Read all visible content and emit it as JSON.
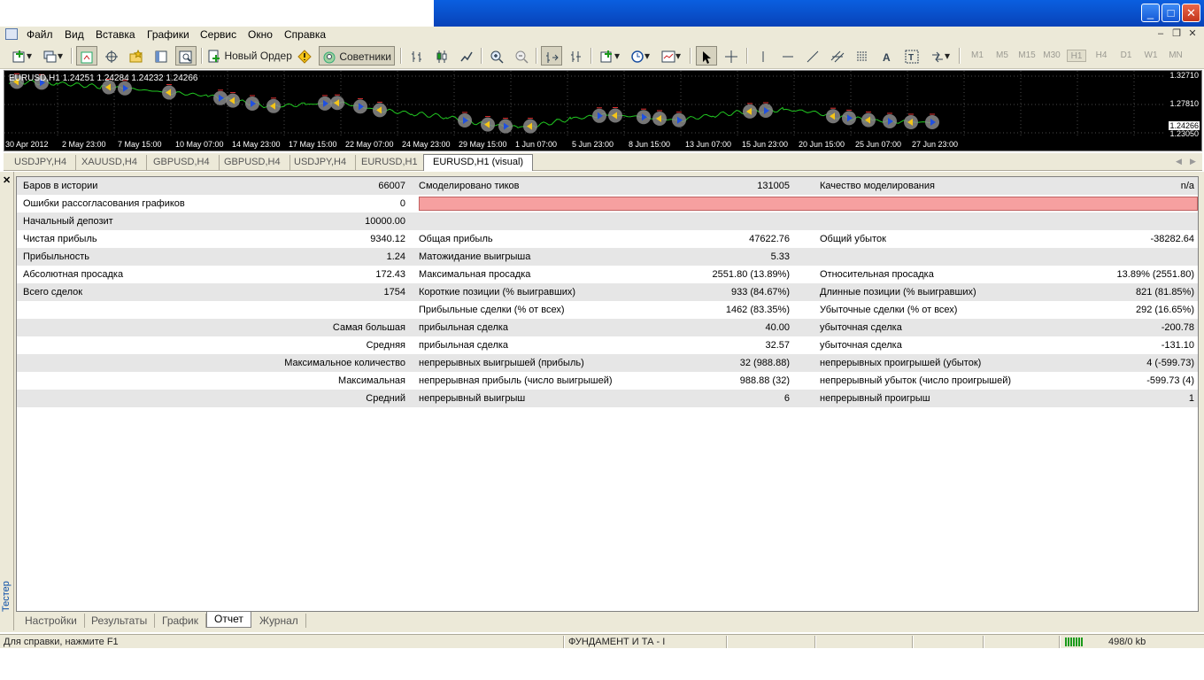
{
  "menu": [
    "Файл",
    "Вид",
    "Вставка",
    "Графики",
    "Сервис",
    "Окно",
    "Справка"
  ],
  "toolbar": {
    "new_order": "Новый Ордер",
    "advisors": "Советники",
    "timeframes": [
      "M1",
      "M5",
      "M15",
      "M30",
      "H1",
      "H4",
      "D1",
      "W1",
      "MN"
    ],
    "active_timeframe": "H1"
  },
  "chart": {
    "symbol_line": "EURUSD,H1  1.24251 1.24284 1.24232 1.24266",
    "prices": [
      "1.32710",
      "1.27810",
      "1.23050"
    ],
    "current_price": "1.24266",
    "times": [
      "30 Apr 2012",
      "2 May 23:00",
      "7 May 15:00",
      "10 May 07:00",
      "14 May 23:00",
      "17 May 15:00",
      "22 May 07:00",
      "24 May 23:00",
      "29 May 15:00",
      "1 Jun 07:00",
      "5 Jun 23:00",
      "8 Jun 15:00",
      "13 Jun 07:00",
      "15 Jun 23:00",
      "20 Jun 15:00",
      "25 Jun 07:00",
      "27 Jun 23:00"
    ],
    "line_color": "#21c721"
  },
  "chart_tabs": [
    "USDJPY,H4",
    "XAUUSD,H4",
    "GBPUSD,H4",
    "GBPUSD,H4",
    "USDJPY,H4",
    "EURUSD,H1",
    "EURUSD,H1 (visual)"
  ],
  "report": {
    "r1": {
      "l1": "Баров в истории",
      "v1": "66007",
      "l2": "Смоделировано тиков",
      "v2": "131005",
      "l3": "Качество моделирования",
      "v3": "n/a"
    },
    "r2": {
      "l1": "Ошибки рассогласования графиков",
      "v1": "0"
    },
    "r3": {
      "l1": "Начальный депозит",
      "v1": "10000.00"
    },
    "r4": {
      "l1": "Чистая прибыль",
      "v1": "9340.12",
      "l2": "Общая прибыль",
      "v2": "47622.76",
      "l3": "Общий убыток",
      "v3": "-38282.64"
    },
    "r5": {
      "l1": "Прибыльность",
      "v1": "1.24",
      "l2": "Матожидание выигрыша",
      "v2": "5.33"
    },
    "r6": {
      "l1": "Абсолютная просадка",
      "v1": "172.43",
      "l2": "Максимальная просадка",
      "v2": "2551.80 (13.89%)",
      "l3": "Относительная просадка",
      "v3": "13.89% (2551.80)"
    },
    "r7": {
      "l1": "Всего сделок",
      "v1": "1754",
      "l2": "Короткие позиции (% выигравших)",
      "v2": "933 (84.67%)",
      "l3": "Длинные позиции (% выигравших)",
      "v3": "821 (81.85%)"
    },
    "r8": {
      "l2": "Прибыльные сделки (% от всех)",
      "v2": "1462 (83.35%)",
      "l3": "Убыточные сделки (% от всех)",
      "v3": "292 (16.65%)"
    },
    "r9": {
      "l1": "Самая большая",
      "l2": "прибыльная сделка",
      "v2": "40.00",
      "l3": "убыточная сделка",
      "v3": "-200.78"
    },
    "r10": {
      "l1": "Средняя",
      "l2": "прибыльная сделка",
      "v2": "32.57",
      "l3": "убыточная сделка",
      "v3": "-131.10"
    },
    "r11": {
      "l1": "Максимальное количество",
      "l2": "непрерывных выигрышей (прибыль)",
      "v2": "32 (988.88)",
      "l3": "непрерывных проигрышей (убыток)",
      "v3": "4 (-599.73)"
    },
    "r12": {
      "l1": "Максимальная",
      "l2": "непрерывная прибыль (число выигрышей)",
      "v2": "988.88 (32)",
      "l3": "непрерывный убыток (число проигрышей)",
      "v3": "-599.73 (4)"
    },
    "r13": {
      "l1": "Средний",
      "l2": "непрерывный выигрыш",
      "v2": "6",
      "l3": "непрерывный проигрыш",
      "v3": "1"
    }
  },
  "side_label": "Тестер",
  "bottom_tabs": [
    "Настройки",
    "Результаты",
    "График",
    "Отчет",
    "Журнал"
  ],
  "active_bottom_tab": "Отчет",
  "status": {
    "help": "Для справки, нажмите F1",
    "profile": "ФУНДАМЕНТ И ТА - I",
    "traffic": "498/0 kb"
  }
}
